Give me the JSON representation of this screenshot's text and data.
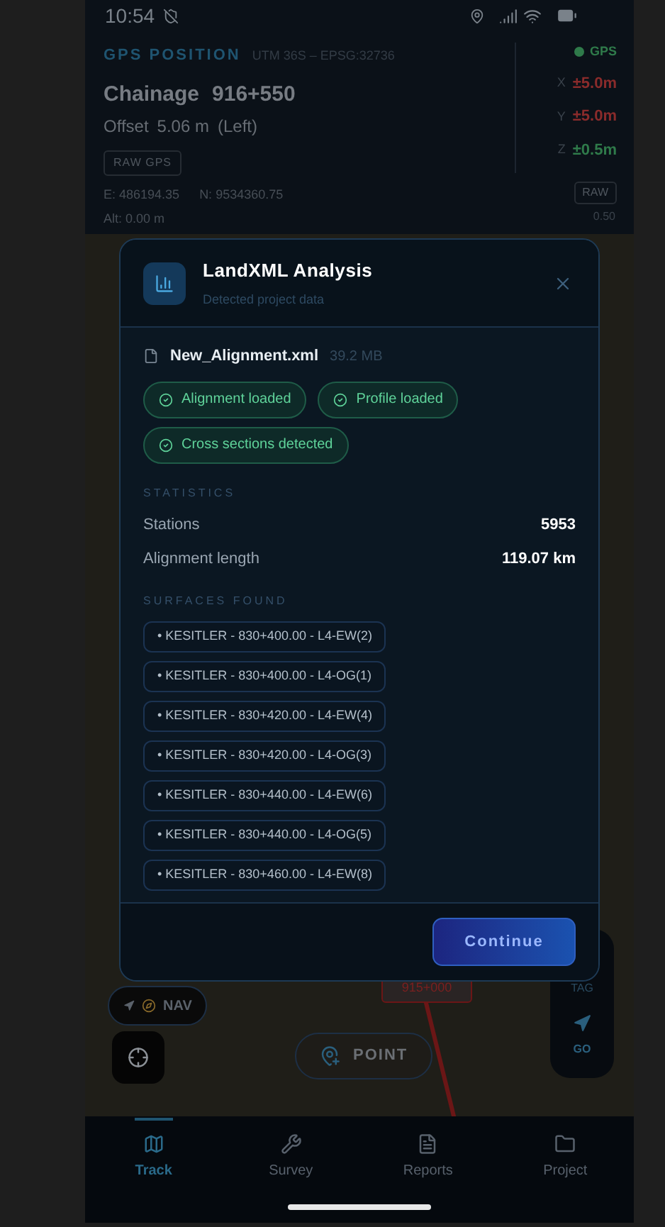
{
  "status_bar": {
    "time": "10:54"
  },
  "gps_panel": {
    "title": "GPS POSITION",
    "crs": "UTM 36S – EPSG:32736",
    "chainage_label": "Chainage",
    "chainage": "916+550",
    "offset_label": "Offset",
    "offset": "5.06 m",
    "offset_side": "(Left)",
    "raw_gps_button": "RAW GPS",
    "easting": "E: 486194.35",
    "northing": "N: 9534360.75",
    "altitude": "Alt: 0.00 m",
    "fix": {
      "label": "GPS",
      "color": "#2f7a4a"
    },
    "accuracy": [
      {
        "axis": "X",
        "value": "±5.0m",
        "color": "#8a2b2b"
      },
      {
        "axis": "Y",
        "value": "±5.0m",
        "color": "#8a2b2b"
      },
      {
        "axis": "Z",
        "value": "±0.5m",
        "color": "#2f7a4a"
      }
    ],
    "raw_button": "RAW",
    "raw_value": "0.50"
  },
  "map": {
    "station_label": "915+000",
    "nav_button": "NAV",
    "point_button": "POINT",
    "tag_button": "TAG",
    "go_button": "GO"
  },
  "dialog": {
    "title": "LandXML Analysis",
    "subtitle": "Detected project data",
    "file_name": "New_Alignment.xml",
    "file_size": "39.2 MB",
    "badges": [
      "Alignment loaded",
      "Profile loaded",
      "Cross sections detected"
    ],
    "statistics_heading": "STATISTICS",
    "statistics": [
      {
        "label": "Stations",
        "value": "5953"
      },
      {
        "label": "Alignment length",
        "value": "119.07 km"
      }
    ],
    "surfaces_heading": "SURFACES FOUND",
    "surfaces": [
      "• KESITLER - 830+400.00 - L4-EW(2)",
      "• KESITLER - 830+400.00 - L4-OG(1)",
      "• KESITLER - 830+420.00 - L4-EW(4)",
      "• KESITLER - 830+420.00 - L4-OG(3)",
      "• KESITLER - 830+440.00 - L4-EW(6)",
      "• KESITLER - 830+440.00 - L4-OG(5)",
      "• KESITLER - 830+460.00 - L4-EW(8)"
    ],
    "continue_button": "Continue"
  },
  "tab_bar": [
    {
      "label": "Track",
      "selected": true
    },
    {
      "label": "Survey",
      "selected": false
    },
    {
      "label": "Reports",
      "selected": false
    },
    {
      "label": "Project",
      "selected": false
    }
  ]
}
